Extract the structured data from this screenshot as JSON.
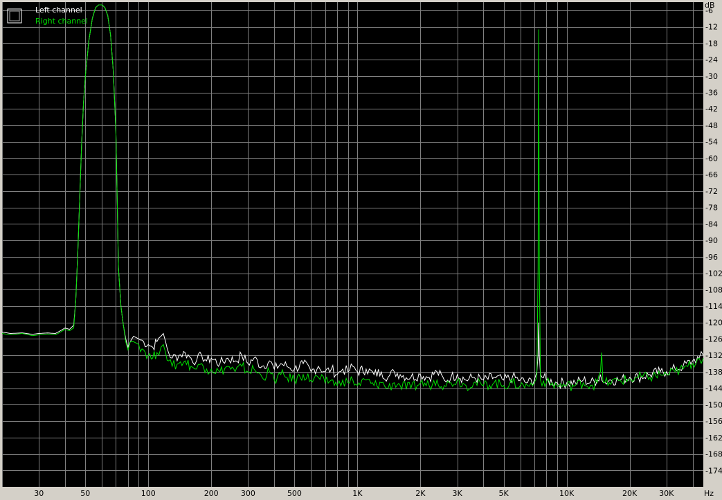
{
  "chart_data": {
    "type": "line",
    "xlabel": "Hz",
    "ylabel": "dB",
    "x_scale": "log",
    "xlim": [
      20,
      45000
    ],
    "ylim": [
      -180,
      -3
    ],
    "grid": true,
    "legend_position": "top-left",
    "colors": {
      "background": "#000000",
      "grid": "#808080",
      "frame": "#d4d0c8",
      "left": "#ffffff",
      "right": "#00e000"
    },
    "y_ticks": [
      -6,
      -12,
      -18,
      -24,
      -30,
      -36,
      -42,
      -48,
      -54,
      -60,
      -66,
      -72,
      -78,
      -84,
      -90,
      -96,
      -102,
      -108,
      -114,
      -120,
      -126,
      -132,
      -138,
      -144,
      -150,
      -156,
      -162,
      -168,
      -174
    ],
    "y_tick_labels": [
      "-6",
      "-12",
      "-18",
      "-24",
      "-30",
      "-36",
      "-42",
      "-48",
      "-54",
      "-60",
      "-66",
      "-72",
      "-78",
      "-84",
      "-90",
      "-96",
      "-102",
      "-108",
      "-114",
      "-120",
      "-126",
      "-132",
      "-138",
      "-144",
      "-150",
      "-156",
      "-162",
      "-168",
      "-174"
    ],
    "x_ticks": [
      {
        "value": 30,
        "label": "30"
      },
      {
        "value": 50,
        "label": "50"
      },
      {
        "value": 100,
        "label": "100"
      },
      {
        "value": 200,
        "label": "200"
      },
      {
        "value": 300,
        "label": "300"
      },
      {
        "value": 500,
        "label": "500"
      },
      {
        "value": 1000,
        "label": "1K"
      },
      {
        "value": 2000,
        "label": "2K"
      },
      {
        "value": 3000,
        "label": "3K"
      },
      {
        "value": 5000,
        "label": "5K"
      },
      {
        "value": 10000,
        "label": "10K"
      },
      {
        "value": 20000,
        "label": "20K"
      },
      {
        "value": 30000,
        "label": "30K"
      }
    ],
    "legend_icon": "spectrum-icon",
    "series": [
      {
        "name": "Left channel",
        "color": "#ffffff",
        "points": [
          [
            20,
            -123.5
          ],
          [
            22,
            -124
          ],
          [
            25,
            -123.8
          ],
          [
            28,
            -124.3
          ],
          [
            30,
            -124
          ],
          [
            33,
            -123.8
          ],
          [
            36,
            -124
          ],
          [
            38,
            -123
          ],
          [
            40,
            -122
          ],
          [
            42,
            -122.5
          ],
          [
            44,
            -121
          ],
          [
            45,
            -112
          ],
          [
            46,
            -95
          ],
          [
            47,
            -75
          ],
          [
            48,
            -55
          ],
          [
            49,
            -40
          ],
          [
            50,
            -30
          ],
          [
            52,
            -17
          ],
          [
            54,
            -9
          ],
          [
            56,
            -5
          ],
          [
            58,
            -4
          ],
          [
            60,
            -4
          ],
          [
            62,
            -5
          ],
          [
            64,
            -8
          ],
          [
            66,
            -15
          ],
          [
            68,
            -28
          ],
          [
            70,
            -50
          ],
          [
            71,
            -75
          ],
          [
            72,
            -100
          ],
          [
            74,
            -114
          ],
          [
            76,
            -121
          ],
          [
            78,
            -126
          ],
          [
            80,
            -129
          ],
          [
            82,
            -127
          ],
          [
            85,
            -125
          ],
          [
            90,
            -126
          ],
          [
            95,
            -127
          ],
          [
            100,
            -128
          ],
          [
            105,
            -129
          ],
          [
            110,
            -127
          ],
          [
            115,
            -125
          ],
          [
            118,
            -124
          ],
          [
            121,
            -127
          ],
          [
            125,
            -131
          ],
          [
            130,
            -133
          ],
          [
            140,
            -132
          ],
          [
            150,
            -131
          ],
          [
            160,
            -133
          ],
          [
            170,
            -134
          ],
          [
            180,
            -132
          ],
          [
            190,
            -134
          ],
          [
            200,
            -133
          ],
          [
            220,
            -135
          ],
          [
            240,
            -133
          ],
          [
            260,
            -134
          ],
          [
            280,
            -132
          ],
          [
            300,
            -135
          ],
          [
            320,
            -133
          ],
          [
            350,
            -136
          ],
          [
            380,
            -134
          ],
          [
            400,
            -137
          ],
          [
            430,
            -135
          ],
          [
            460,
            -136
          ],
          [
            500,
            -137
          ],
          [
            550,
            -135
          ],
          [
            600,
            -138
          ],
          [
            650,
            -136
          ],
          [
            700,
            -138
          ],
          [
            750,
            -137
          ],
          [
            800,
            -139
          ],
          [
            850,
            -137
          ],
          [
            900,
            -138
          ],
          [
            950,
            -136
          ],
          [
            1000,
            -138
          ],
          [
            1100,
            -137
          ],
          [
            1200,
            -139
          ],
          [
            1300,
            -138
          ],
          [
            1400,
            -140
          ],
          [
            1500,
            -138
          ],
          [
            1600,
            -139
          ],
          [
            1800,
            -140
          ],
          [
            2000,
            -139
          ],
          [
            2200,
            -140
          ],
          [
            2400,
            -138
          ],
          [
            2600,
            -141
          ],
          [
            2800,
            -140
          ],
          [
            3000,
            -139
          ],
          [
            3300,
            -141
          ],
          [
            3600,
            -140
          ],
          [
            4000,
            -141
          ],
          [
            4500,
            -140
          ],
          [
            5000,
            -141
          ],
          [
            5500,
            -140
          ],
          [
            6000,
            -141
          ],
          [
            6500,
            -142
          ],
          [
            7000,
            -141
          ],
          [
            7200,
            -138
          ],
          [
            7300,
            -132
          ],
          [
            7350,
            -120
          ],
          [
            7400,
            -132
          ],
          [
            7500,
            -139
          ],
          [
            8000,
            -141
          ],
          [
            9000,
            -142
          ],
          [
            10000,
            -142
          ],
          [
            11000,
            -142
          ],
          [
            12000,
            -141
          ],
          [
            13000,
            -142
          ],
          [
            14000,
            -141
          ],
          [
            14500,
            -139
          ],
          [
            14700,
            -141
          ],
          [
            15000,
            -142
          ],
          [
            16000,
            -141
          ],
          [
            18000,
            -141
          ],
          [
            20000,
            -140
          ],
          [
            22000,
            -140
          ],
          [
            25000,
            -139
          ],
          [
            28000,
            -138
          ],
          [
            30000,
            -138
          ],
          [
            33000,
            -137
          ],
          [
            36000,
            -136
          ],
          [
            40000,
            -134
          ],
          [
            43000,
            -133
          ],
          [
            45000,
            -132
          ]
        ]
      },
      {
        "name": "Right channel",
        "color": "#00e000",
        "points": [
          [
            20,
            -124
          ],
          [
            22,
            -124.5
          ],
          [
            25,
            -124
          ],
          [
            28,
            -124.8
          ],
          [
            30,
            -124.5
          ],
          [
            33,
            -124.2
          ],
          [
            36,
            -124.5
          ],
          [
            38,
            -123.5
          ],
          [
            40,
            -122.5
          ],
          [
            42,
            -123
          ],
          [
            44,
            -122
          ],
          [
            45,
            -112
          ],
          [
            46,
            -95
          ],
          [
            47,
            -75
          ],
          [
            48,
            -55
          ],
          [
            49,
            -40
          ],
          [
            50,
            -30
          ],
          [
            52,
            -17
          ],
          [
            54,
            -9
          ],
          [
            56,
            -5
          ],
          [
            58,
            -4
          ],
          [
            60,
            -4
          ],
          [
            62,
            -5
          ],
          [
            64,
            -8
          ],
          [
            66,
            -15
          ],
          [
            68,
            -28
          ],
          [
            70,
            -50
          ],
          [
            71,
            -75
          ],
          [
            72,
            -100
          ],
          [
            74,
            -114
          ],
          [
            76,
            -121
          ],
          [
            78,
            -127
          ],
          [
            80,
            -130
          ],
          [
            82,
            -127
          ],
          [
            85,
            -127
          ],
          [
            90,
            -128
          ],
          [
            95,
            -130
          ],
          [
            100,
            -132
          ],
          [
            105,
            -133
          ],
          [
            110,
            -131
          ],
          [
            115,
            -129
          ],
          [
            118,
            -128
          ],
          [
            121,
            -131
          ],
          [
            125,
            -134
          ],
          [
            130,
            -136
          ],
          [
            140,
            -135
          ],
          [
            150,
            -134
          ],
          [
            160,
            -136
          ],
          [
            170,
            -137
          ],
          [
            180,
            -135
          ],
          [
            190,
            -137
          ],
          [
            200,
            -137
          ],
          [
            220,
            -138
          ],
          [
            240,
            -136
          ],
          [
            260,
            -138
          ],
          [
            280,
            -136
          ],
          [
            300,
            -138
          ],
          [
            320,
            -137
          ],
          [
            350,
            -140
          ],
          [
            380,
            -138
          ],
          [
            400,
            -141
          ],
          [
            430,
            -139
          ],
          [
            460,
            -140
          ],
          [
            500,
            -141
          ],
          [
            550,
            -139
          ],
          [
            600,
            -141
          ],
          [
            650,
            -140
          ],
          [
            700,
            -142
          ],
          [
            750,
            -141
          ],
          [
            800,
            -143
          ],
          [
            850,
            -141
          ],
          [
            900,
            -142
          ],
          [
            950,
            -141
          ],
          [
            1000,
            -143
          ],
          [
            1100,
            -141
          ],
          [
            1200,
            -143
          ],
          [
            1300,
            -142
          ],
          [
            1400,
            -144
          ],
          [
            1500,
            -142
          ],
          [
            1600,
            -143
          ],
          [
            1800,
            -144
          ],
          [
            2000,
            -142
          ],
          [
            2200,
            -143
          ],
          [
            2400,
            -141
          ],
          [
            2600,
            -143
          ],
          [
            2800,
            -142
          ],
          [
            3000,
            -141
          ],
          [
            3300,
            -143
          ],
          [
            3600,
            -142
          ],
          [
            4000,
            -143
          ],
          [
            4500,
            -142
          ],
          [
            5000,
            -143
          ],
          [
            5500,
            -142
          ],
          [
            6000,
            -143
          ],
          [
            6500,
            -143
          ],
          [
            7000,
            -142
          ],
          [
            7200,
            -140
          ],
          [
            7300,
            -100
          ],
          [
            7350,
            -13
          ],
          [
            7400,
            -100
          ],
          [
            7500,
            -141
          ],
          [
            8000,
            -142
          ],
          [
            9000,
            -143
          ],
          [
            10000,
            -143
          ],
          [
            11000,
            -143
          ],
          [
            12000,
            -142
          ],
          [
            13000,
            -143
          ],
          [
            14000,
            -142
          ],
          [
            14500,
            -138
          ],
          [
            14700,
            -131
          ],
          [
            14900,
            -141
          ],
          [
            15000,
            -142
          ],
          [
            16000,
            -142
          ],
          [
            18000,
            -141
          ],
          [
            20000,
            -141
          ],
          [
            22000,
            -140
          ],
          [
            25000,
            -140
          ],
          [
            28000,
            -139
          ],
          [
            30000,
            -139
          ],
          [
            33000,
            -138
          ],
          [
            36000,
            -137
          ],
          [
            40000,
            -135
          ],
          [
            43000,
            -133
          ],
          [
            45000,
            -133
          ]
        ]
      }
    ]
  }
}
